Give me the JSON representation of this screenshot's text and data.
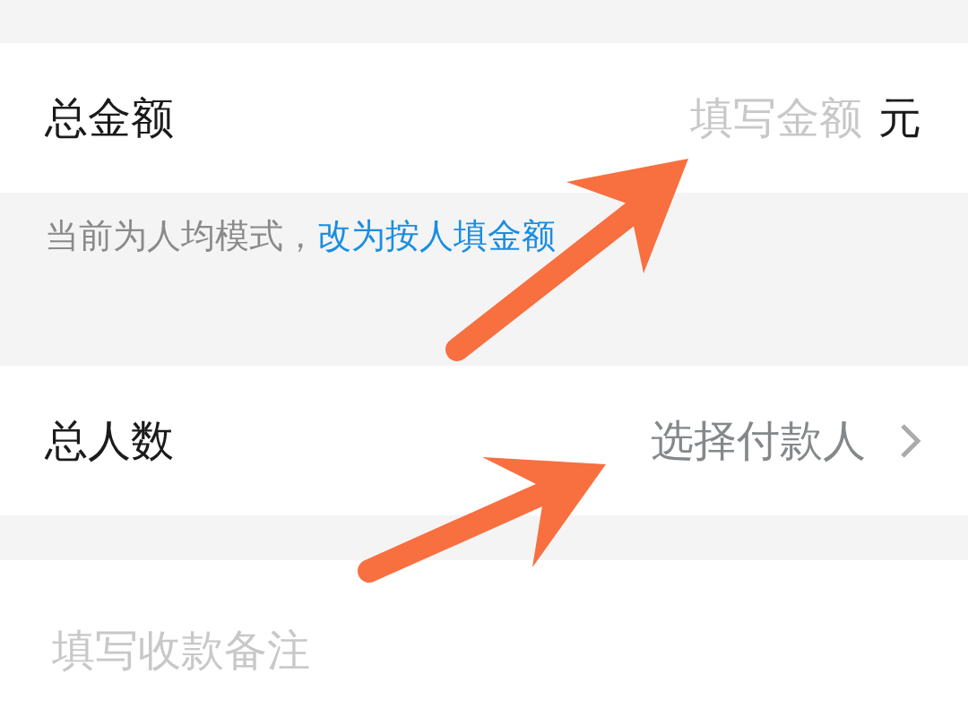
{
  "amount_row": {
    "label": "总金额",
    "field": {
      "placeholder": "填写金额"
    },
    "unit": "元"
  },
  "mode_hint": {
    "text": "当前为人均模式，",
    "link": "改为按人填金额"
  },
  "people_row": {
    "label": "总人数",
    "value": "选择付款人"
  },
  "note": {
    "placeholder": "填写收款备注"
  }
}
